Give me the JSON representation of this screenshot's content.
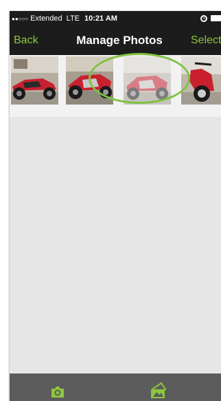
{
  "status_bar": {
    "signal": "●●○○○",
    "carrier": "Extended",
    "network": "LTE",
    "time": "10:21 AM",
    "alarm_icon": "alarm-icon",
    "battery_icon": "battery-icon"
  },
  "nav": {
    "back_label": "Back",
    "title": "Manage Photos",
    "select_label": "Select"
  },
  "photos": [
    {
      "name": "motorcycle photo 1",
      "selected": false
    },
    {
      "name": "motorcycle photo 2",
      "selected": false
    },
    {
      "name": "motorcycle photo 3",
      "selected": true
    },
    {
      "name": "motorcycle photo 4",
      "selected": false
    }
  ],
  "toolbar": {
    "camera_icon": "camera-icon",
    "library_icon": "photo-library-icon"
  },
  "colors": {
    "accent": "#8cc63f",
    "nav_background": "#1c1c1c",
    "toolbar_background": "#5c5c5c",
    "content_background": "#e6e6e6",
    "highlight_circle": "#7fc242",
    "motorcycle_red": "#c8202f"
  }
}
